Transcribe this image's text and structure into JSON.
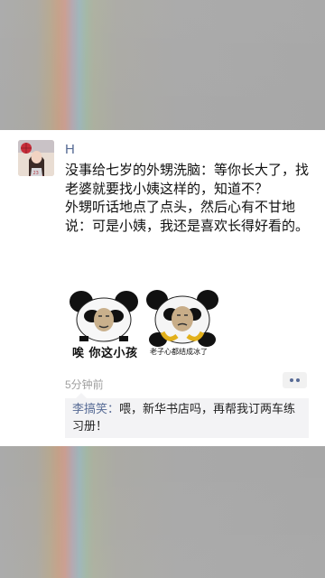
{
  "post": {
    "username": "H",
    "paragraph1": "没事给七岁的外甥洗脑：等你长大了，找老婆就要找小姨这样的，知道不？",
    "paragraph2": "外甥听话地点了点头，然后心有不甘地说：可是小姨，我还是喜欢长得好看的。",
    "images": [
      {
        "caption": "唉 你这小孩",
        "icon": "panda-meme-sigh"
      },
      {
        "caption": "老子心都结成冰了",
        "icon": "panda-meme-frozen-heart"
      }
    ],
    "timestamp": "5分钟前",
    "more_icon": "more-dots-icon"
  },
  "comment": {
    "author": "李搞笑：",
    "text": "喂，新华书店吗，再帮我订两车练习册！"
  },
  "colors": {
    "link": "#576b95",
    "timestamp": "#a0a0a0",
    "comment_bg": "#f3f3f5",
    "card_bg": "#ffffff"
  }
}
